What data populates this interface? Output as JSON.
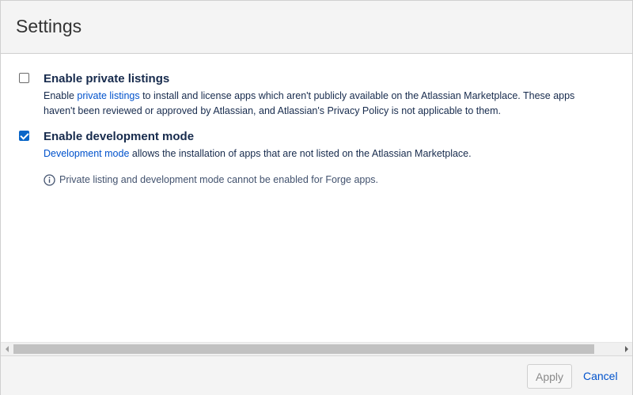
{
  "dialog": {
    "title": "Settings"
  },
  "options": [
    {
      "checked": false,
      "title": "Enable private listings",
      "desc_prefix": "Enable ",
      "desc_link": "private listings",
      "desc_suffix": " to install and license apps which aren't publicly available on the Atlassian Marketplace. These apps haven't been reviewed or approved by Atlassian, and Atlassian's Privacy Policy is not applicable to them."
    },
    {
      "checked": true,
      "title": "Enable development mode",
      "desc_prefix": "",
      "desc_link": "Development mode",
      "desc_suffix": " allows the installation of apps that are not listed on the Atlassian Marketplace."
    }
  ],
  "info": {
    "icon": "info-icon",
    "text": "Private listing and development mode cannot be enabled for Forge apps."
  },
  "footer": {
    "apply_label": "Apply",
    "cancel_label": "Cancel"
  },
  "colors": {
    "link": "#0052cc",
    "checkbox_checked": "#0a66c8",
    "header_bg": "#f4f4f4"
  }
}
